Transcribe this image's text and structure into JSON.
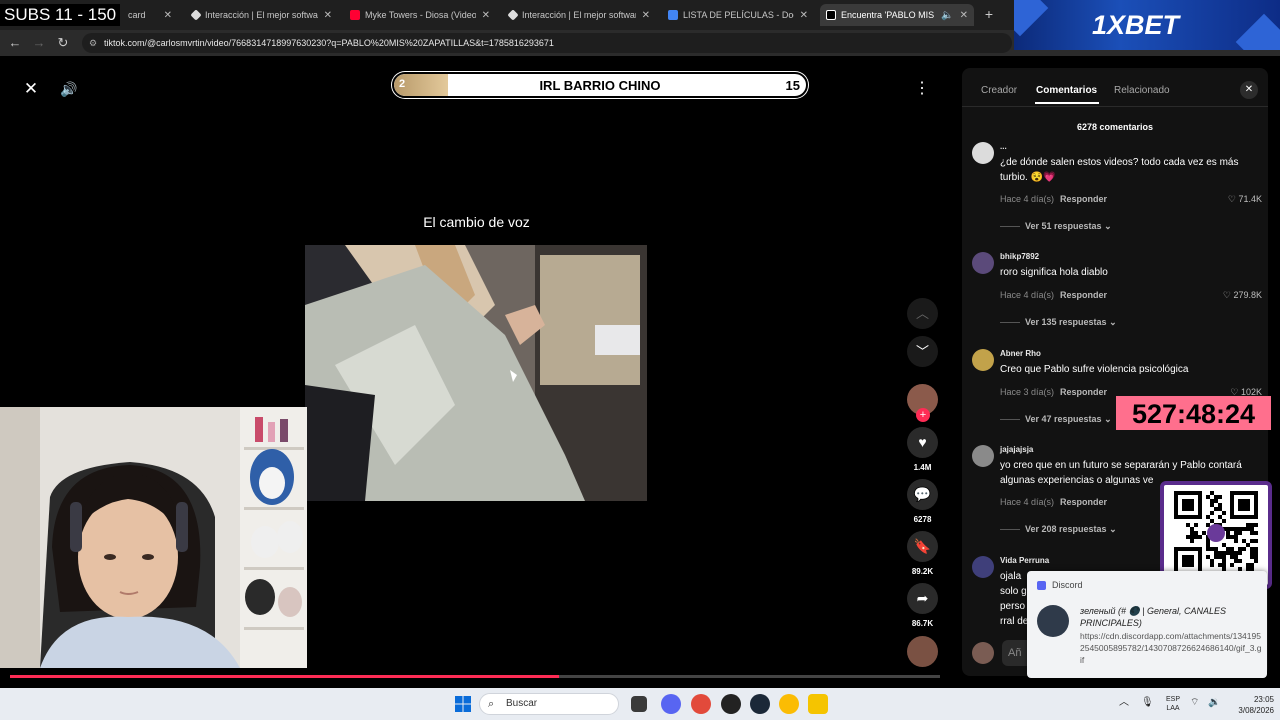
{
  "stream_overlay": {
    "subs_counter": "SUBS 11 - 150",
    "goal_bar": {
      "left_value": "2",
      "title": "IRL BARRIO CHINO",
      "right_value": "15",
      "progress_fraction": 0.13
    },
    "timer": "527:48:24"
  },
  "browser": {
    "tabs": [
      {
        "label": "card",
        "icon": "subs-overlay",
        "color": "#888888"
      },
      {
        "label": "Interacción | El mejor software",
        "icon": "interaction-icon",
        "color": "#dddddd"
      },
      {
        "label": "Myke Towers - Diosa (Video Of",
        "icon": "youtube-icon",
        "color": "#ff0033"
      },
      {
        "label": "Interacción | El mejor software",
        "icon": "interaction-icon",
        "color": "#dddddd"
      },
      {
        "label": "LISTA DE PELÍCULAS - Documen",
        "icon": "docs-icon",
        "color": "#4285f4"
      },
      {
        "label": "Encuentra 'PABLO MIS ZAP",
        "icon": "tiktok-icon",
        "color": "#ffffff",
        "active": true
      }
    ],
    "url": "tiktok.com/@carlosmvrtin/video/7668314718997630230?q=PABLO%20MIS%20ZAPATILLAS&t=1785816293671"
  },
  "ad": {
    "brand": "1XBET",
    "brand_color": "#1b4fb8"
  },
  "video": {
    "caption": "El cambio de voz",
    "actions": {
      "likes": "1.4M",
      "comments": "6278",
      "saves": "89.2K",
      "shares": "86.7K"
    },
    "playback_fraction": 0.59
  },
  "panel": {
    "tabs": [
      "Creador",
      "Comentarios",
      "Relacionado"
    ],
    "comment_count": "6278 comentarios",
    "reply_label": "Responder",
    "comments": [
      {
        "user": "...",
        "text": "¿de dónde salen estos videos? todo cada vez es más turbio. 😵💗",
        "time": "Hace 4 día(s)",
        "likes": "71.4K",
        "replies": "Ver 51 respuestas",
        "avatar_color": "#dcdcdc"
      },
      {
        "user": "bhikp7892",
        "text": "roro significa hola diablo",
        "time": "Hace 4 día(s)",
        "likes": "279.8K",
        "replies": "Ver 135 respuestas",
        "avatar_color": "#5b4a7a"
      },
      {
        "user": "Abner Rho",
        "text": "Creo que Pablo sufre violencia psicológica",
        "time": "Hace 3 día(s)",
        "likes": "102K",
        "replies": "Ver 47 respuestas",
        "avatar_color": "#c2a24a"
      },
      {
        "user": "jajajajsja",
        "text": "yo creo que en un futuro se separarán y Pablo contará algunas experiencias o algunas ve",
        "time": "Hace 4 día(s)",
        "likes": "",
        "replies": "Ver 208 respuestas",
        "avatar_color": "#8a8a8a"
      },
      {
        "user": "Vida Perruna",
        "text": "ojala\nsolo g\nperso\nrral de",
        "time": "",
        "likes": "",
        "replies": "",
        "avatar_color": "#3f3f7a"
      }
    ],
    "input_placeholder": "Añ"
  },
  "discord": {
    "app": "Discord",
    "title": "зеленый (# 🌑 | General, CANALES PRINCIPALES)",
    "body": "https://cdn.discordapp.com/attachments/1341952545005895782/1430708726624686140/gif_3.gif"
  },
  "taskbar": {
    "search_placeholder": "Buscar",
    "lang_top": "ESP",
    "lang_bottom": "LAA",
    "time": "23:05",
    "date": "3/08/2026"
  }
}
